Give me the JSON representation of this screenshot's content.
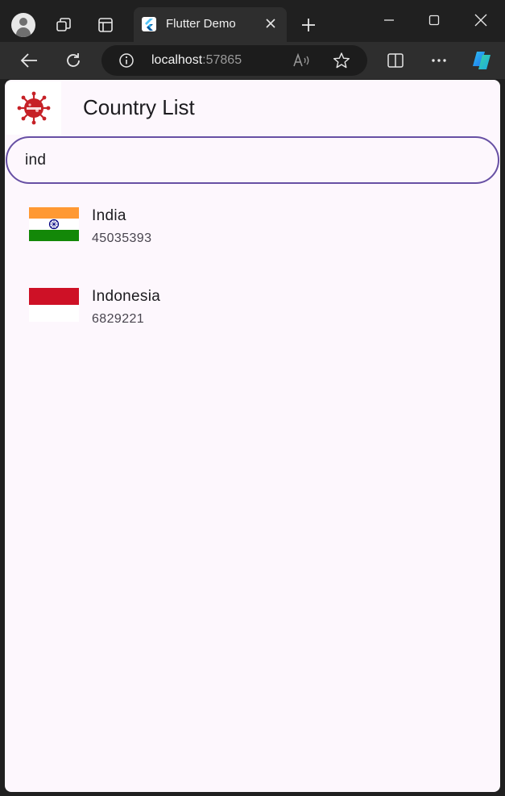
{
  "browser": {
    "tab_title": "Flutter Demo",
    "url_host": "localhost",
    "url_port": ":57865",
    "icons": {
      "profile": "profile-icon",
      "workspaces": "workspaces-icon",
      "tab_actions": "tab-actions-icon",
      "favicon": "flutter-favicon",
      "close_tab": "close-icon",
      "new_tab": "plus-icon",
      "minimize": "minimize-icon",
      "maximize": "maximize-icon",
      "close_window": "close-icon",
      "back": "back-arrow-icon",
      "refresh": "refresh-icon",
      "site_info": "info-icon",
      "read_aloud": "read-aloud-icon",
      "favorite": "star-icon",
      "split_screen": "split-screen-icon",
      "more": "more-icon",
      "copilot": "copilot-icon"
    }
  },
  "app": {
    "title": "Country List",
    "logo_icon": "virus-icon",
    "search": {
      "value": "ind",
      "border_color": "#6750a4"
    },
    "countries": [
      {
        "name": "India",
        "cases": "45035393",
        "flag_icon": "india-flag-icon"
      },
      {
        "name": "Indonesia",
        "cases": "6829221",
        "flag_icon": "indonesia-flag-icon"
      }
    ],
    "colors": {
      "background": "#fdf7fd",
      "text": "#1c1b1f",
      "subtext": "#49454f"
    }
  }
}
